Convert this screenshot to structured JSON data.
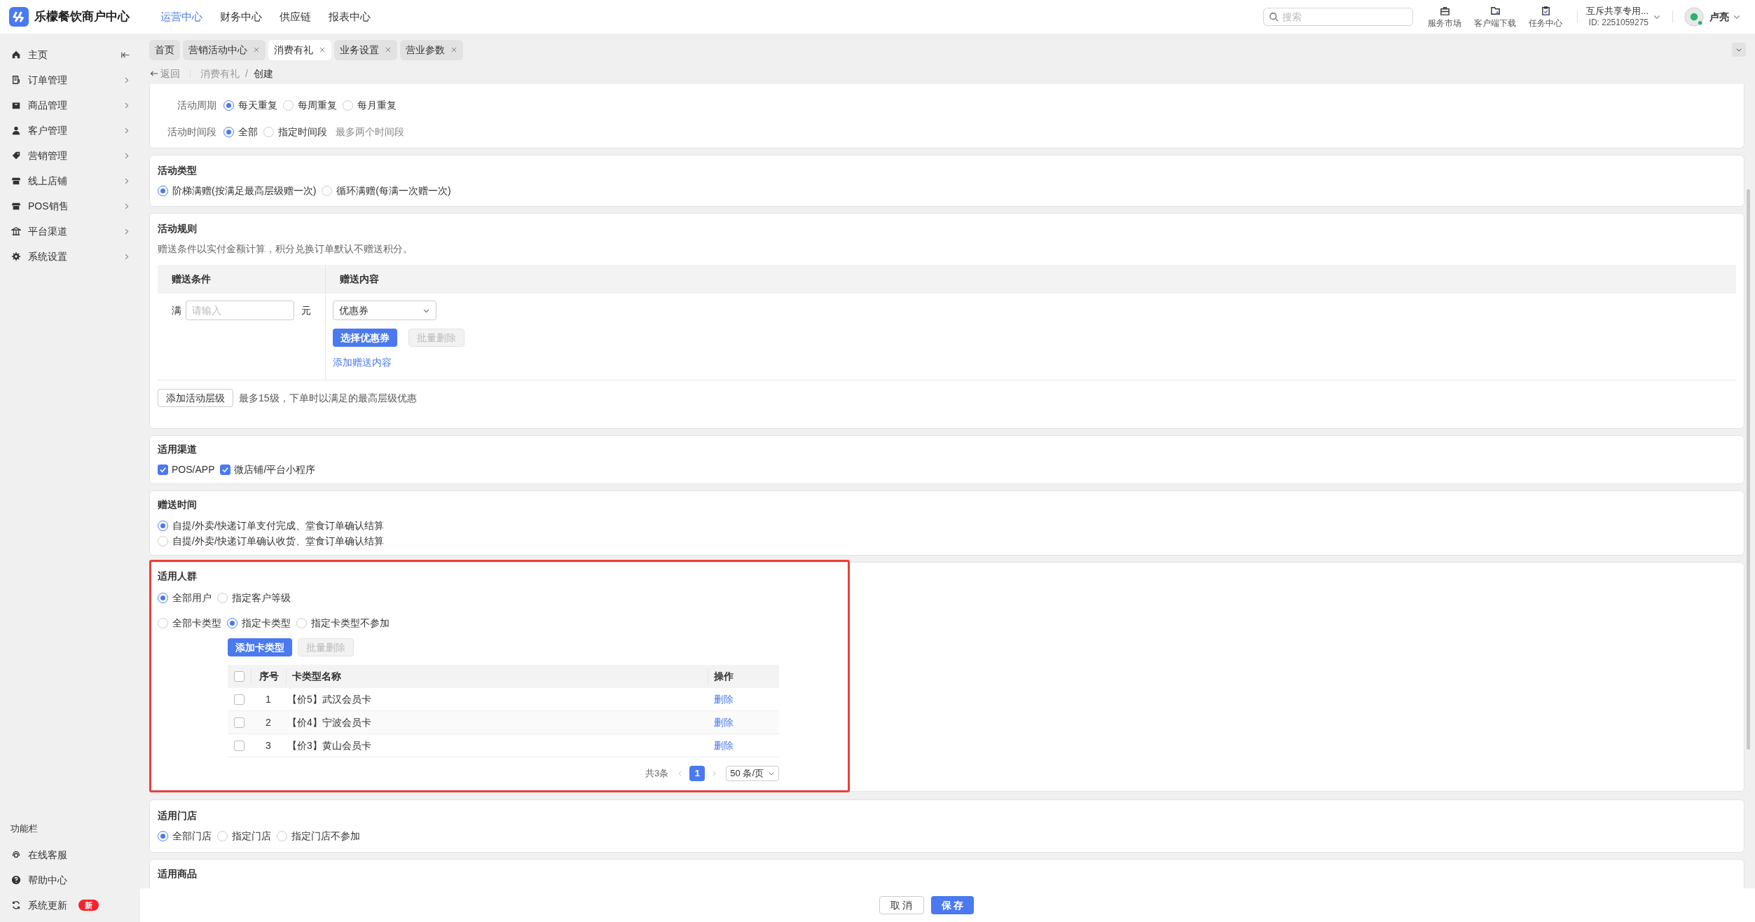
{
  "app": {
    "name": "乐檬餐饮商户中心"
  },
  "top_nav": [
    {
      "label": "运营中心",
      "selected": true
    },
    {
      "label": "财务中心",
      "selected": false
    },
    {
      "label": "供应链",
      "selected": false
    },
    {
      "label": "报表中心",
      "selected": false
    }
  ],
  "search": {
    "placeholder": "搜索"
  },
  "toolbar": [
    {
      "label": "服务市场",
      "kind": "briefcase"
    },
    {
      "label": "客户端下载",
      "kind": "download"
    },
    {
      "label": "任务中心",
      "kind": "task"
    }
  ],
  "account": {
    "name": "互斥共享专用...",
    "id": "ID: 2251059275"
  },
  "user": {
    "name": "卢亮"
  },
  "sidebar": {
    "items": [
      {
        "label": "主页",
        "kind": "home"
      },
      {
        "label": "订单管理",
        "kind": "order"
      },
      {
        "label": "商品管理",
        "kind": "box"
      },
      {
        "label": "客户管理",
        "kind": "person"
      },
      {
        "label": "营销管理",
        "kind": "tag"
      },
      {
        "label": "线上店铺",
        "kind": "store"
      },
      {
        "label": "POS销售",
        "kind": "store"
      },
      {
        "label": "平台渠道",
        "kind": "bank"
      },
      {
        "label": "系统设置",
        "kind": "gear"
      }
    ],
    "section_title": "功能栏",
    "footer_items": [
      {
        "label": "在线客服",
        "kind": "headset"
      },
      {
        "label": "帮助中心",
        "kind": "help"
      },
      {
        "label": "系统更新",
        "kind": "refresh",
        "badge": "新"
      }
    ]
  },
  "tabs": [
    {
      "label": "首页",
      "closable": false,
      "selected": false
    },
    {
      "label": "营销活动中心",
      "closable": true,
      "selected": false
    },
    {
      "label": "消费有礼",
      "closable": true,
      "selected": true
    },
    {
      "label": "业务设置",
      "closable": true,
      "selected": false
    },
    {
      "label": "营业参数",
      "closable": true,
      "selected": false
    }
  ],
  "breadcrumb": {
    "back": "返回",
    "separator": "/",
    "items": [
      "消费有礼",
      "创建"
    ]
  },
  "period": {
    "rows": [
      {
        "label": "活动周期",
        "options": [
          {
            "label": "每天重复",
            "selected": true
          },
          {
            "label": "每周重复",
            "selected": false
          },
          {
            "label": "每月重复",
            "selected": false
          }
        ]
      },
      {
        "label": "活动时间段",
        "options": [
          {
            "label": "全部",
            "selected": true
          },
          {
            "label": "指定时间段",
            "selected": false
          }
        ],
        "hint": "最多两个时间段"
      }
    ]
  },
  "activity_type": {
    "title": "活动类型",
    "options": [
      {
        "label": "阶梯满赠(按满足最高层级赠一次)",
        "selected": true
      },
      {
        "label": "循环满赠(每满一次赠一次)",
        "selected": false
      }
    ]
  },
  "rules": {
    "title": "活动规则",
    "note": "赠送条件以实付金额计算，积分兑换订单默认不赠送积分。",
    "columns": [
      "赠送条件",
      "赠送内容"
    ],
    "condition": {
      "prefix": "满",
      "placeholder": "请输入",
      "suffix": "元"
    },
    "content": {
      "select": "优惠券",
      "buttons": [
        {
          "label": "选择优惠券",
          "disabled": false
        },
        {
          "label": "批量删除",
          "disabled": true
        }
      ],
      "add_link": "添加赠送内容"
    },
    "add_level_button": "添加活动层级",
    "add_level_hint": "最多15级，下单时以满足的最高层级优惠"
  },
  "channels": {
    "title": "适用渠道",
    "options": [
      {
        "label": "POS/APP",
        "checked": true
      },
      {
        "label": "微店铺/平台小程序",
        "checked": true
      }
    ]
  },
  "gift_time": {
    "title": "赠送时间",
    "options": [
      {
        "label": "自提/外卖/快递订单支付完成、堂食订单确认结算",
        "selected": true
      },
      {
        "label": "自提/外卖/快递订单确认收货、堂食订单确认结算",
        "selected": false
      }
    ]
  },
  "audience": {
    "title": "适用人群",
    "highlighted": true,
    "user_options": [
      {
        "label": "全部用户",
        "selected": true
      },
      {
        "label": "指定客户等级",
        "selected": false
      }
    ],
    "card_options": [
      {
        "label": "全部卡类型",
        "selected": false
      },
      {
        "label": "指定卡类型",
        "selected": true
      },
      {
        "label": "指定卡类型不参加",
        "selected": false
      }
    ],
    "buttons": [
      {
        "label": "添加卡类型",
        "disabled": false
      },
      {
        "label": "批量删除",
        "disabled": true
      }
    ],
    "table": {
      "all_checked": false,
      "columns": [
        "序号",
        "卡类型名称",
        "操作"
      ],
      "rows": [
        {
          "index": "1",
          "name": "【价5】武汉会员卡",
          "action": "删除",
          "checked": false
        },
        {
          "index": "2",
          "name": "【价4】宁波会员卡",
          "action": "删除",
          "checked": false
        },
        {
          "index": "3",
          "name": "【价3】黄山会员卡",
          "action": "删除",
          "checked": false
        }
      ]
    },
    "pagination": {
      "total": "共3条",
      "pages": [
        {
          "label": "1",
          "selected": true
        }
      ],
      "page_size": "50 条/页"
    }
  },
  "stores": {
    "title": "适用门店",
    "options": [
      {
        "label": "全部门店",
        "selected": true
      },
      {
        "label": "指定门店",
        "selected": false
      },
      {
        "label": "指定门店不参加",
        "selected": false
      }
    ]
  },
  "products": {
    "title": "适用商品"
  },
  "footer": {
    "cancel": "取 消",
    "save": "保 存"
  }
}
